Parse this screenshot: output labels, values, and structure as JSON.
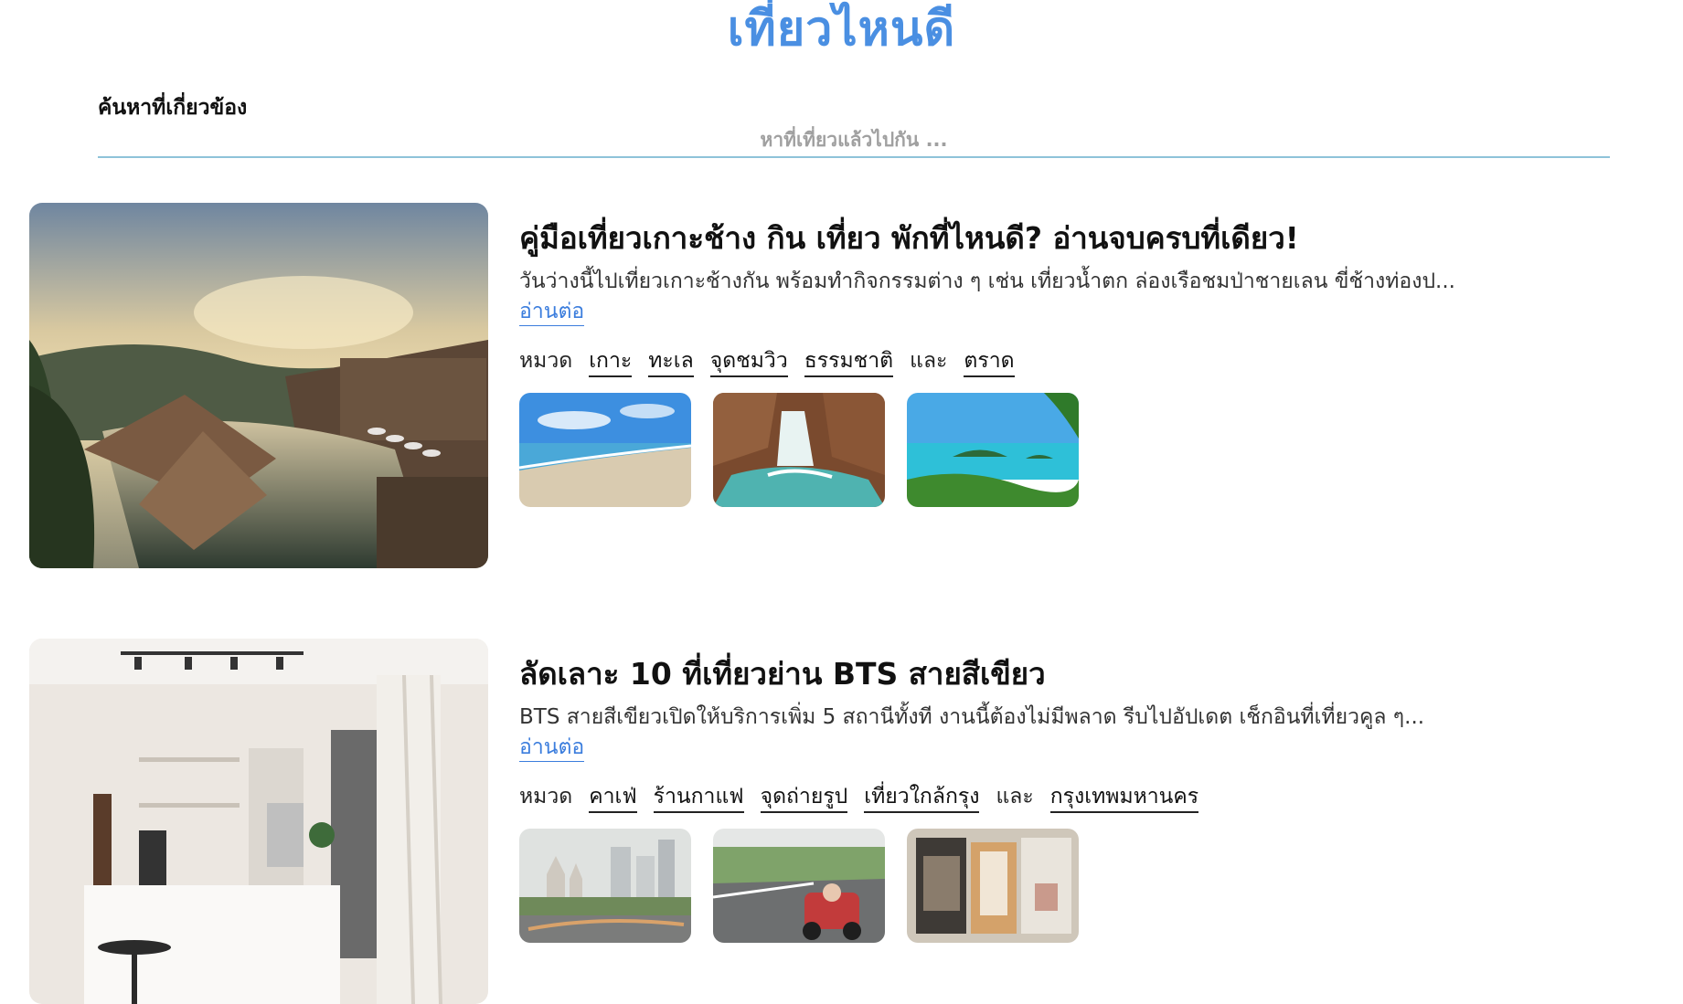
{
  "header": {
    "title": "เที่ยวไหนดี"
  },
  "search": {
    "label": "ค้นหาที่เกี่ยวข้อง",
    "placeholder": "หาที่เที่ยวแล้วไปกัน ...",
    "value": ""
  },
  "articles": [
    {
      "title": "คู่มือเที่ยวเกาะช้าง กิน เที่ยว พักที่ไหนดี? อ่านจบครบที่เดียว!",
      "excerpt": "วันว่างนี้ไปเที่ยวเกาะช้างกัน พร้อมทำกิจกรรมต่าง ๆ เช่น เที่ยวน้ำตก ล่องเรือชมป่าชายเลน ขี่ช้างท่องป...",
      "read_more": "อ่านต่อ",
      "category_label": "หมวด",
      "categories": [
        "เกาะ",
        "ทะเล",
        "จุดชมวิว",
        "ธรรมชาติ"
      ],
      "conjunction": "และ",
      "location": "ตราด"
    },
    {
      "title": "ลัดเลาะ 10 ที่เที่ยวย่าน BTS สายสีเขียว",
      "excerpt": "BTS สายสีเขียวเปิดให้บริการเพิ่ม 5 สถานีทั้งที งานนี้ต้องไม่มีพลาด รีบไปอัปเดต เช็กอินที่เที่ยวคูล ๆ...",
      "read_more": "อ่านต่อ",
      "category_label": "หมวด",
      "categories": [
        "คาเฟ่",
        "ร้านกาแฟ",
        "จุดถ่ายรูป",
        "เที่ยวใกล้กรุง"
      ],
      "conjunction": "และ",
      "location": "กรุงเทพมหานคร"
    }
  ],
  "colors": {
    "title_blue": "#4a8fe2",
    "link_blue": "#3b7ddd",
    "search_underline": "#8ec3d9"
  }
}
